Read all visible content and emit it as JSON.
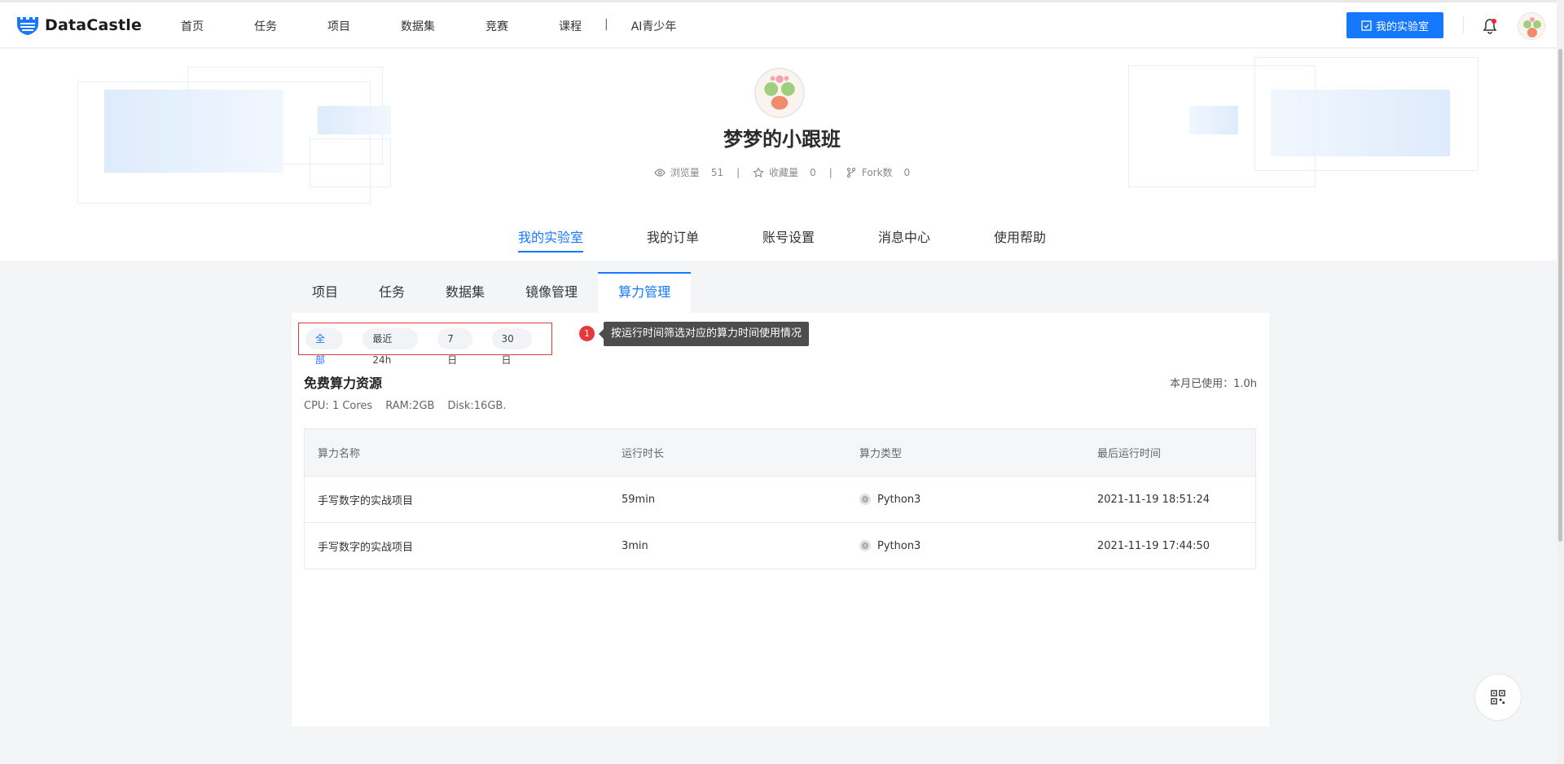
{
  "brand": {
    "name": "DataCastle",
    "accent": "#1677ff"
  },
  "nav": {
    "items": [
      "首页",
      "任务",
      "项目",
      "数据集",
      "竞赛",
      "课程"
    ],
    "separator": "|",
    "last_item": "AI青少年",
    "lab_button": "我的实验室"
  },
  "profile": {
    "username": "梦梦的小跟班",
    "stats": [
      {
        "icon": "eye-icon",
        "label": "浏览量",
        "value": "51"
      },
      {
        "icon": "star-icon",
        "label": "收藏量",
        "value": "0"
      },
      {
        "icon": "fork-icon",
        "label": "Fork数",
        "value": "0"
      }
    ],
    "stat_separator": "|",
    "tabs": [
      "我的实验室",
      "我的订单",
      "账号设置",
      "消息中心",
      "使用帮助"
    ],
    "active_tab": "我的实验室"
  },
  "subtabs": {
    "items": [
      "项目",
      "任务",
      "数据集",
      "镜像管理",
      "算力管理"
    ],
    "active": "算力管理"
  },
  "filters": {
    "chips": [
      "全部",
      "最近24h",
      "7日",
      "30日"
    ],
    "active": "全部",
    "badge": "1",
    "tooltip": "按运行时间筛选对应的算力时间使用情况"
  },
  "resource": {
    "title": "免费算力资源",
    "usage": "本月已使用：1.0h",
    "specs": [
      "CPU: 1 Cores",
      "RAM:2GB",
      "Disk:16GB."
    ]
  },
  "table": {
    "columns": [
      "算力名称",
      "运行时长",
      "算力类型",
      "最后运行时间"
    ],
    "rows": [
      [
        "手写数字的实战项目",
        "59min",
        "Python3",
        "2021-11-19 18:51:24"
      ],
      [
        "手写数字的实战项目",
        "3min",
        "Python3",
        "2021-11-19 17:44:50"
      ]
    ]
  }
}
